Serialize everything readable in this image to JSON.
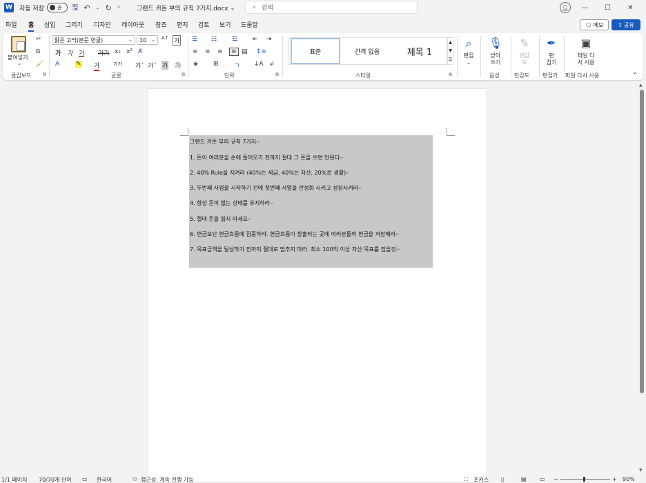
{
  "titlebar": {
    "app_icon_letter": "W",
    "autosave_label": "자동 저장",
    "autosave_state": "끔",
    "doc_title": "그랜드 카돈 부의 규칙 7가지.docx",
    "search_placeholder": "검색"
  },
  "menu": {
    "tabs": [
      "파일",
      "홈",
      "삽입",
      "그리기",
      "디자인",
      "레이아웃",
      "참조",
      "편지",
      "검토",
      "보기",
      "도움말"
    ],
    "active_tab": "홈",
    "memo_label": "메모",
    "share_label": "공유"
  },
  "ribbon": {
    "clipboard": {
      "paste_label": "붙여넣기",
      "group_label": "클립보드"
    },
    "font": {
      "font_name": "맑은 고딕(본문 한글)",
      "font_size": "10",
      "group_label": "글꼴"
    },
    "paragraph": {
      "group_label": "단락"
    },
    "styles": {
      "items": [
        "표준",
        "간격 없음",
        "제목 1"
      ],
      "selected": "표준",
      "group_label": "스타일"
    },
    "editing": {
      "label": "편집"
    },
    "voice": {
      "dictate_label": "받아\n쓰기",
      "group_label": "음성"
    },
    "sensitivity": {
      "label": "민감\n도",
      "group_label": "민감도"
    },
    "editor": {
      "label": "편\n집기",
      "group_label": "편집기"
    },
    "reuse": {
      "label": "파일 다\n시 사용",
      "group_label": "파일 다시 사용"
    }
  },
  "document": {
    "lines": [
      "그랜드 카돈 부의 규칙 7가지",
      "1. 돈이 여러분을 손에 들어오기 전까지 절대 그 돈을 쓰면 안된다",
      "2. 40% Rule을 지켜라 (40%는 세금, 40%는 자산, 20%로 생활)",
      "3. 두번째 사업을 시작하기 전에 첫번째 사업을 안정화 시키고 성장시켜라",
      "4. 항상 돈이 없는 상태를 유지하라",
      "5. 절대 돈을 잃지 마세요",
      "6. 현금보단 현금흐름에 집중하라. 현금흐름이 창출되는 곳에 여러분들의 현금을 저장해라",
      "7. 목표금액을 달성하기 전까지 절대로 멈추지 마라. 최소 100억 이상 자산 목표를 잡을것"
    ],
    "paragraph_mark": "↵"
  },
  "statusbar": {
    "page": "1/1 페이지",
    "words": "70/70개 단어",
    "language": "한국어",
    "accessibility": "접근성: 계속 진행 가능",
    "focus": "포커스",
    "zoom": "90%"
  }
}
